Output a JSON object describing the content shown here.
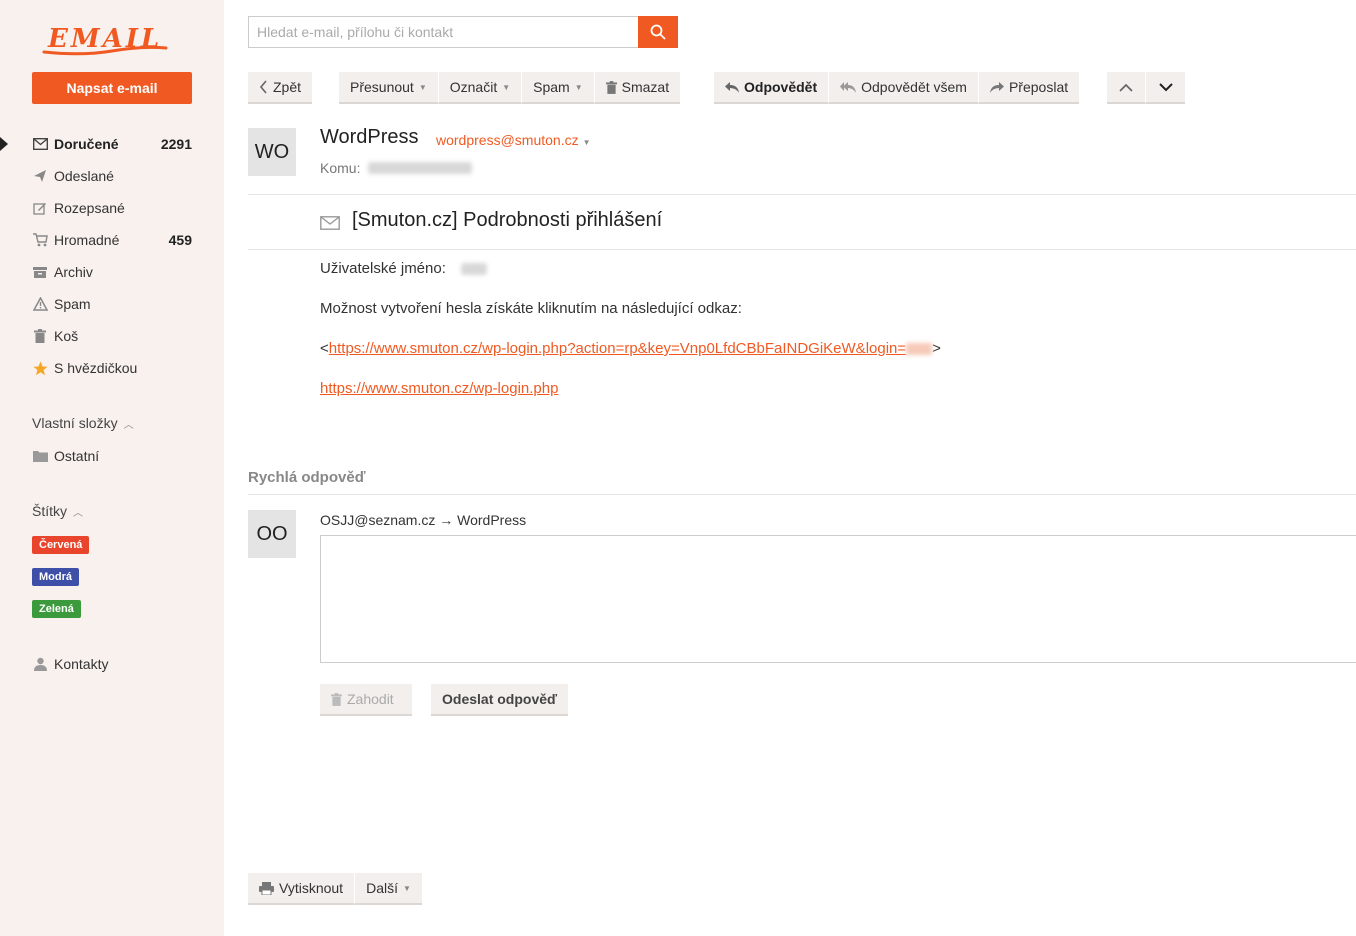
{
  "app": {
    "logo_text": "EMAIL",
    "brand_color": "#f05a22"
  },
  "sidebar": {
    "compose_label": "Napsat e-mail",
    "folders": [
      {
        "label": "Doručené",
        "count": "2291",
        "icon": "inbox-icon",
        "active": true
      },
      {
        "label": "Odeslané",
        "count": "",
        "icon": "send-icon"
      },
      {
        "label": "Rozepsané",
        "count": "",
        "icon": "draft-icon"
      },
      {
        "label": "Hromadné",
        "count": "459",
        "icon": "cart-icon"
      },
      {
        "label": "Archiv",
        "count": "",
        "icon": "archive-icon"
      },
      {
        "label": "Spam",
        "count": "",
        "icon": "warning-icon"
      },
      {
        "label": "Koš",
        "count": "",
        "icon": "trash-icon"
      },
      {
        "label": "S hvězdičkou",
        "count": "",
        "icon": "star-icon"
      }
    ],
    "custom_folders_title": "Vlastní složky",
    "custom_folders": [
      {
        "label": "Ostatní",
        "icon": "folder-icon"
      }
    ],
    "labels_title": "Štítky",
    "labels": [
      {
        "label": "Červená",
        "color": "#e8452c"
      },
      {
        "label": "Modrá",
        "color": "#3d4fa7"
      },
      {
        "label": "Zelená",
        "color": "#3a9a3c"
      }
    ],
    "contacts_label": "Kontakty"
  },
  "search": {
    "placeholder": "Hledat e-mail, přílohu či kontakt"
  },
  "toolbar": {
    "back": "Zpět",
    "move": "Přesunout",
    "mark": "Označit",
    "spam": "Spam",
    "delete": "Smazat",
    "reply": "Odpovědět",
    "reply_all": "Odpovědět všem",
    "forward": "Přeposlat"
  },
  "message": {
    "avatar": "WO",
    "sender_name": "WordPress",
    "sender_email": "wordpress@smuton.cz",
    "to_label": "Komu:",
    "subject": "[Smuton.cz] Podrobnosti přihlášení",
    "body": {
      "username_label": "Uživatelské jméno:",
      "instruction": "Možnost vytvoření hesla získáte kliknutím na následující odkaz:",
      "link_prefix": "<",
      "reset_link": "https://www.smuton.cz/wp-login.php?action=rp&key=Vnp0LfdCBbFaINDGiKeW&login=",
      "link_suffix": ">",
      "login_link": "https://www.smuton.cz/wp-login.php"
    }
  },
  "quick_reply": {
    "title": "Rychlá odpověď",
    "avatar": "OO",
    "route": "OSJJ@seznam.cz → WordPress",
    "discard": "Zahodit",
    "send": "Odeslat odpověď"
  },
  "footer": {
    "print": "Vytisknout",
    "more": "Další"
  }
}
